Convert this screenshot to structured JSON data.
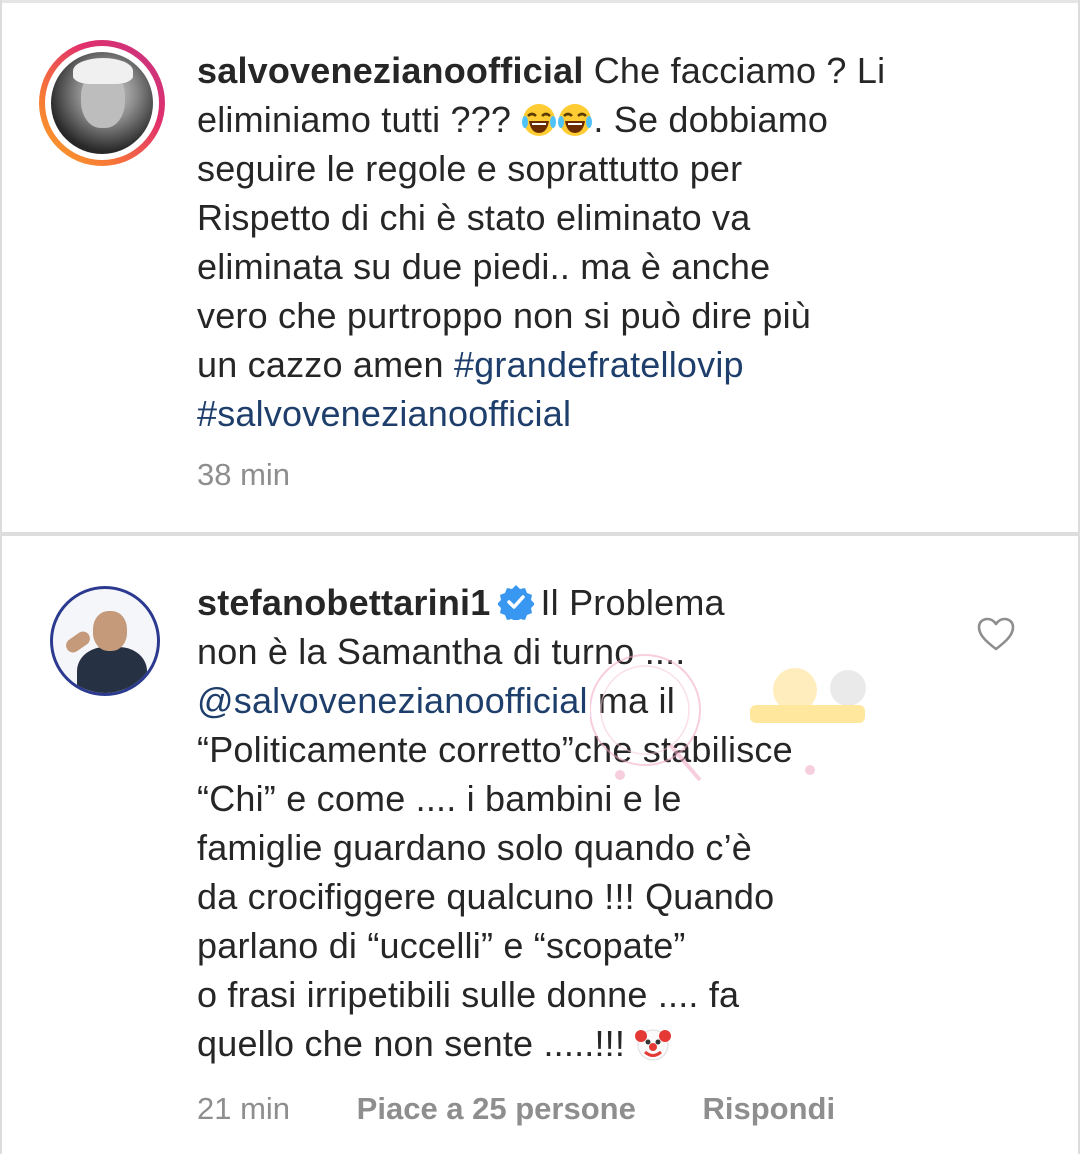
{
  "comments": [
    {
      "username": "salvovenezianoofficial",
      "text_lines": [
        "Che facciamo ? Li",
        "eliminiamo tutti ??? ",
        ". Se dobbiamo",
        "seguire le regole e soprattutto per",
        "Rispetto di chi è stato eliminato va",
        "eliminata su due piedi.. ma è anche",
        "vero che purtroppo non si può dire più",
        "un cazzo  amen "
      ],
      "hashtag_1": "#grandefratellovip",
      "hashtag_2": "#salvovenezianoofficial",
      "emoji": "laughing-tears-emoji",
      "time": "38 min"
    },
    {
      "username": "stefanobettarini1",
      "verified": true,
      "line_1": "Il Problema",
      "line_2": "non è la Samantha di turno ....",
      "mention": "@salvovenezianoofficial",
      "line_3_tail": " ma il",
      "line_4": "“Politicamente corretto”che stabilisce",
      "line_5": "“Chi” e come .... i bambini e le",
      "line_6": "famiglie guardano solo quando c’è",
      "line_7": "da crocifiggere qualcuno !!! Quando",
      "line_8": "parlano di “uccelli” e “scopate”",
      "line_9": "o frasi irripetibili sulle donne .... fa",
      "line_10": "quello che non sente .....!!! ",
      "emoji": "clown-emoji",
      "time": "21 min",
      "likes": "Piace a 25 persone",
      "reply": "Rispondi"
    }
  ],
  "icons": {
    "like": "heart-outline-icon",
    "verified": "verified-badge-icon"
  },
  "colors": {
    "link": "#1e3e6b",
    "meta": "#8e8e8e",
    "verified": "#3897f0"
  }
}
